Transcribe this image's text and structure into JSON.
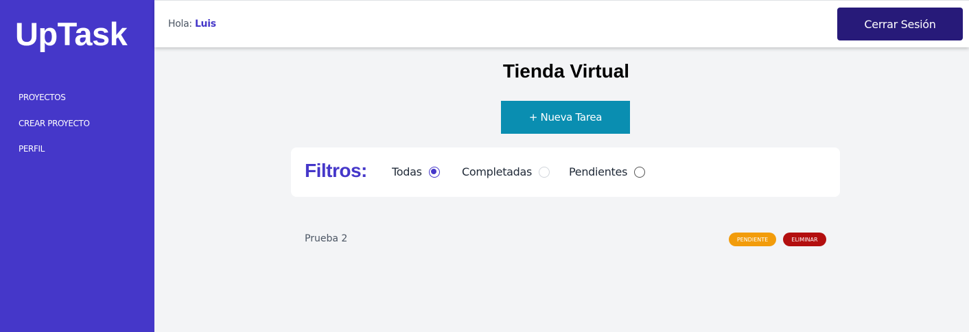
{
  "sidebar": {
    "logo": "UpTask",
    "items": [
      {
        "label": "PROYECTOS"
      },
      {
        "label": "CREAR PROYECTO"
      },
      {
        "label": "PERFIL"
      }
    ]
  },
  "header": {
    "greeting": "Hola:",
    "user": "Luis",
    "logout_label": "Cerrar Sesión"
  },
  "main": {
    "title": "Tienda Virtual",
    "new_task_label": "+ Nueva Tarea"
  },
  "filters": {
    "title": "Filtros:",
    "options": [
      {
        "label": "Todas",
        "checked": true
      },
      {
        "label": "Completadas",
        "checked": false
      },
      {
        "label": "Pendientes",
        "checked": false
      }
    ]
  },
  "tasks": [
    {
      "name": "Prueba 2",
      "status_label": "Pendiente",
      "delete_label": "Eliminar"
    }
  ],
  "colors": {
    "brand": "#4537c9",
    "header_button": "#271a79",
    "new_task_button": "#0a8eb1",
    "pending": "#f29c0b",
    "delete": "#b30f0f"
  }
}
